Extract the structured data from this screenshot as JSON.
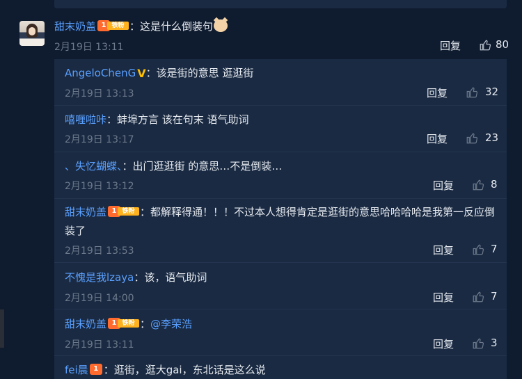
{
  "main_comment": {
    "username": "甜末奶盖",
    "badge_label": "铁粉",
    "badge_crown": "1",
    "text": "：这是什么倒装句",
    "time": "2月19日 13:11",
    "reply_label": "回复",
    "likes": "80"
  },
  "replies": [
    {
      "username": "AngeloChenG",
      "text": "：该是街的意思 逛逛街",
      "time": "2月19日 13:13",
      "reply_label": "回复",
      "likes": "32"
    },
    {
      "username": "嘻喱啦咔",
      "text": "：蚌埠方言 该在句末 语气助词",
      "time": "2月19日 13:17",
      "reply_label": "回复",
      "likes": "23"
    },
    {
      "username": "、失忆蝴蝶、",
      "text": "：出门逛逛街 的意思…不是倒装…",
      "time": "2月19日 13:12",
      "reply_label": "回复",
      "likes": "8"
    },
    {
      "username": "甜末奶盖",
      "badge_label": "铁粉",
      "badge_crown": "1",
      "text": "：都解释得通！！！不过本人想得肯定是逛街的意思哈哈哈哈是我第一反应倒",
      "text2": "装了",
      "time": "2月19日 13:53",
      "reply_label": "回复",
      "likes": "7"
    },
    {
      "username": "不愧是我lzaya",
      "text": "：该，语气助词",
      "time": "2月19日 14:00",
      "reply_label": "回复",
      "likes": "7"
    },
    {
      "username": "甜末奶盖",
      "badge_label": "铁粉",
      "badge_crown": "1",
      "text": "：",
      "mention": "@李荣浩",
      "time": "2月19日 13:11",
      "reply_label": "回复",
      "likes": "3"
    },
    {
      "username": "fei晨",
      "badge_crown": "1",
      "text": "：逛街，逛大gai，东北话是这么说"
    }
  ]
}
